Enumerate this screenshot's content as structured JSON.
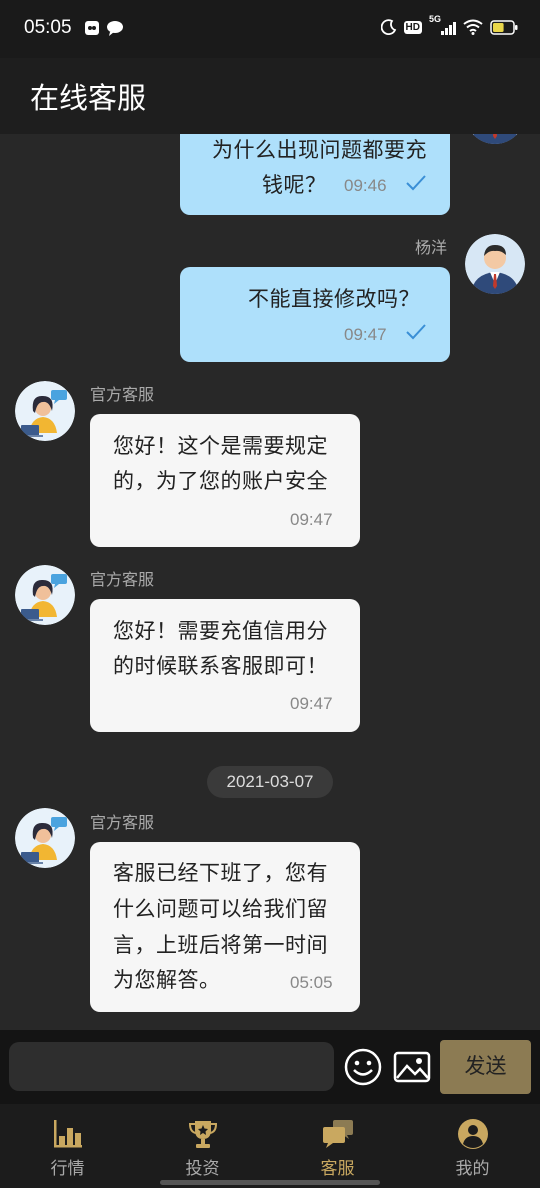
{
  "status_bar": {
    "time": "05:05",
    "network": "5G",
    "hd": "HD",
    "battery_level": 0.56
  },
  "header": {
    "title": "在线客服"
  },
  "messages": [
    {
      "sender": "",
      "text_lines": [
        "为什么出现问题都要充",
        "钱呢？"
      ],
      "time": "09:46",
      "outgoing": true
    },
    {
      "sender": "杨洋",
      "text_lines": [
        "不能直接修改吗？"
      ],
      "time": "09:47",
      "outgoing": true
    },
    {
      "sender": "官方客服",
      "text_lines": [
        "您好！这个是需要规定",
        "的，为了您的账户安全"
      ],
      "time": "09:47",
      "outgoing": false
    },
    {
      "sender": "官方客服",
      "text_lines": [
        "您好！需要充值信用分",
        "的时候联系客服即可！"
      ],
      "time": "09:47",
      "outgoing": false
    },
    {
      "sender": "官方客服",
      "text_lines": [
        "客服已经下班了，您有",
        "什么问题可以给我们留",
        "言，上班后将第一时间",
        "为您解答。"
      ],
      "time": "05:05",
      "outgoing": false
    }
  ],
  "date_separator": "2021-03-07",
  "input_bar": {
    "placeholder": "",
    "send_label": "发送"
  },
  "nav": [
    {
      "label": "行情",
      "icon": "bar-chart-icon",
      "active": false
    },
    {
      "label": "投资",
      "icon": "trophy-icon",
      "active": false
    },
    {
      "label": "客服",
      "icon": "chat-bubbles-icon",
      "active": true
    },
    {
      "label": "我的",
      "icon": "user-icon",
      "active": false
    }
  ],
  "colors": {
    "accent": "#c9a860",
    "outgoing_bubble": "#aee0fb",
    "incoming_bubble": "#f6f6f6",
    "check": "#3a8fd6"
  }
}
